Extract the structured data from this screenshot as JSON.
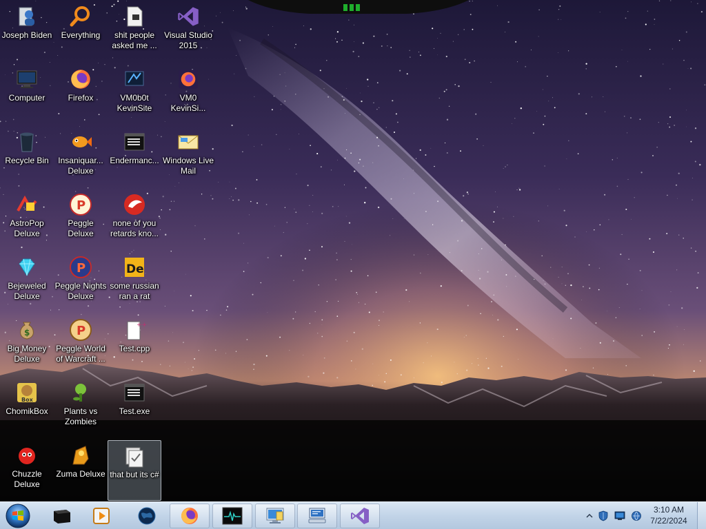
{
  "desktop": {
    "icons": [
      {
        "label": "Joseph Biden",
        "icon": "user-folder-icon"
      },
      {
        "label": "Everything",
        "icon": "magnifier-search-icon"
      },
      {
        "label": "shit people\nasked me ...",
        "icon": "text-file-icon"
      },
      {
        "label": "Visual Studio\n2015",
        "icon": "visual-studio-icon"
      },
      {
        "label": "Computer",
        "icon": "computer-monitor-icon"
      },
      {
        "label": "Firefox",
        "icon": "firefox-icon"
      },
      {
        "label": "VM0b0t\nKevinSite",
        "icon": "vm-shortcut-icon"
      },
      {
        "label": "VM0\nKevinSi...",
        "icon": "firefox-shortcut-icon"
      },
      {
        "label": "Recycle Bin",
        "icon": "recycle-bin-icon"
      },
      {
        "label": "Insaniquar...\nDeluxe",
        "icon": "goldfish-game-icon"
      },
      {
        "label": "Endermanc...",
        "icon": "console-app-icon"
      },
      {
        "label": "Windows Live\nMail",
        "icon": "mail-envelope-icon"
      },
      {
        "label": "AstroPop\nDeluxe",
        "icon": "astropop-game-icon"
      },
      {
        "label": "Peggle Deluxe",
        "icon": "peggle-game-icon"
      },
      {
        "label": "none of you\nretards kno...",
        "icon": "red-bird-icon"
      },
      {
        "label": "Bejeweled\nDeluxe",
        "icon": "diamond-gem-icon"
      },
      {
        "label": "Peggle Nights\nDeluxe",
        "icon": "peggle-nights-game-icon"
      },
      {
        "label": "some russian\nran a rat",
        "icon": "de-letters-icon"
      },
      {
        "label": "Big Money\nDeluxe",
        "icon": "money-bag-icon"
      },
      {
        "label": "Peggle World\nof Warcraft ...",
        "icon": "peggle-wow-game-icon"
      },
      {
        "label": "Test.cpp",
        "icon": "cpp-file-icon"
      },
      {
        "label": "ChomikBox",
        "icon": "chomikbox-icon"
      },
      {
        "label": "Plants vs\nZombies",
        "icon": "plant-game-icon"
      },
      {
        "label": "Test.exe",
        "icon": "console-app-icon"
      },
      {
        "label": "Chuzzle\nDeluxe",
        "icon": "chuzzle-game-icon"
      },
      {
        "label": "Zuma Deluxe",
        "icon": "zuma-frog-icon"
      },
      {
        "label": "that but its c#",
        "icon": "cs-file-icon",
        "selected": true
      }
    ]
  },
  "taskbar": {
    "start": {
      "icon": "windows-start-orb-icon"
    },
    "buttons": [
      {
        "icon": "black-box-app-icon",
        "active": false
      },
      {
        "icon": "media-player-icon",
        "active": false
      },
      {
        "icon": "globe-icon",
        "active": false
      },
      {
        "icon": "firefox-icon",
        "active": true
      },
      {
        "icon": "waveform-monitor-icon",
        "active": true
      },
      {
        "icon": "remote-desktop-icon",
        "active": true
      },
      {
        "icon": "network-computer-icon",
        "active": true
      },
      {
        "icon": "visual-studio-icon",
        "active": true
      }
    ],
    "tray": {
      "icons": [
        "show-hidden-icons-chevron-icon",
        "shield-icon",
        "monitor-icon",
        "network-icon"
      ],
      "time": "3:10 AM",
      "date": "7/22/2024"
    }
  },
  "colors": {
    "taskbar": "#c2d4e8",
    "sky": "#2a1f4a",
    "horizon_glow": "#e7b07a",
    "vs_purple": "#865fc5",
    "firefox_orange": "#ff7139"
  }
}
